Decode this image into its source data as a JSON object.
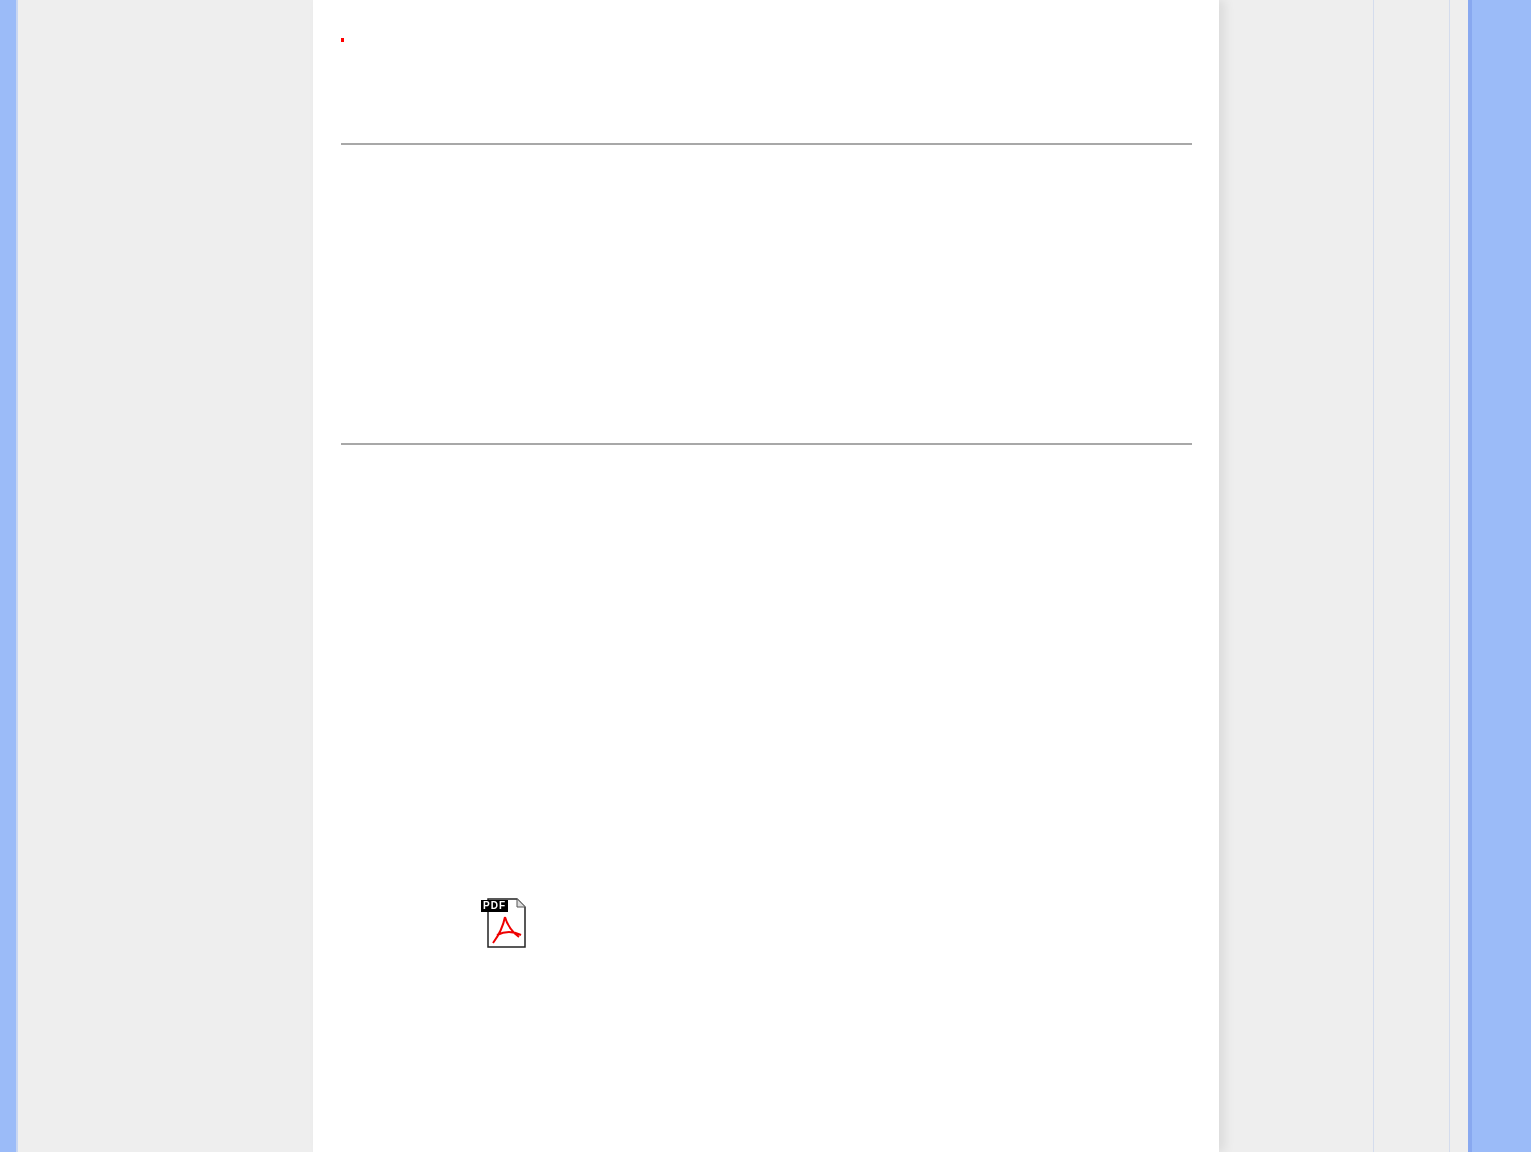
{
  "pdf_link": {
    "icon_label": "PDF"
  }
}
